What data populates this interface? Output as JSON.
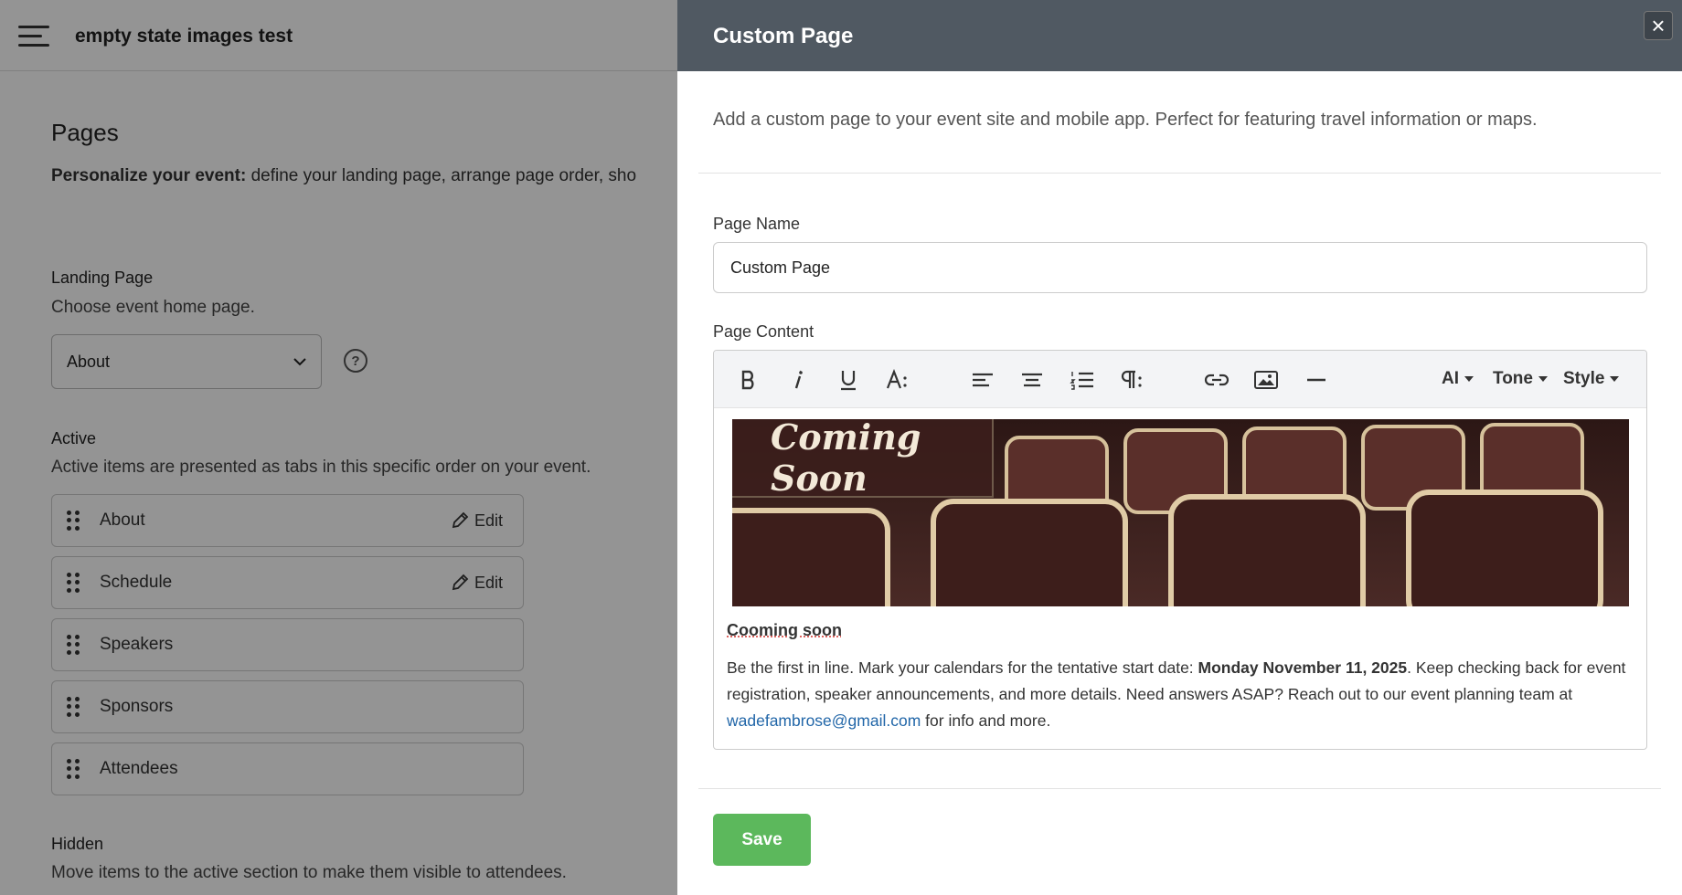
{
  "app": {
    "title": "empty state images test"
  },
  "pages": {
    "title": "Pages",
    "desc_bold": "Personalize your event:",
    "desc_rest": " define your landing page, arrange page order, sho"
  },
  "landing": {
    "title": "Landing Page",
    "desc": "Choose event home page.",
    "selected": "About"
  },
  "active": {
    "title": "Active",
    "desc": "Active items are presented as tabs in this specific order on your event.",
    "items": [
      {
        "label": "About",
        "edit": "Edit"
      },
      {
        "label": "Schedule",
        "edit": "Edit"
      },
      {
        "label": "Speakers"
      },
      {
        "label": "Sponsors"
      },
      {
        "label": "Attendees"
      }
    ]
  },
  "hidden": {
    "title": "Hidden",
    "desc": "Move items to the active section to make them visible to attendees."
  },
  "panel": {
    "title": "Custom Page",
    "close": "×",
    "intro": "Add a custom page to your event site and mobile app. Perfect for featuring travel information or maps.",
    "page_name_label": "Page Name",
    "page_name_value": "Custom Page",
    "page_content_label": "Page Content",
    "toolbar": {
      "ai": "AI",
      "tone": "Tone",
      "style": "Style"
    },
    "banner_text": "Coming Soon",
    "heading": "Cooming soon",
    "para_1": "Be the first in line. Mark your calendars for the tentative start date: ",
    "para_bold": "Monday November 11, 2025",
    "para_2": ". Keep checking back for event registration, speaker announcements, and more details. Need answers ASAP? Reach out to our event planning team at ",
    "para_link": "wadefambrose@gmail.com",
    "para_3": " for info and more.",
    "save": "Save"
  }
}
